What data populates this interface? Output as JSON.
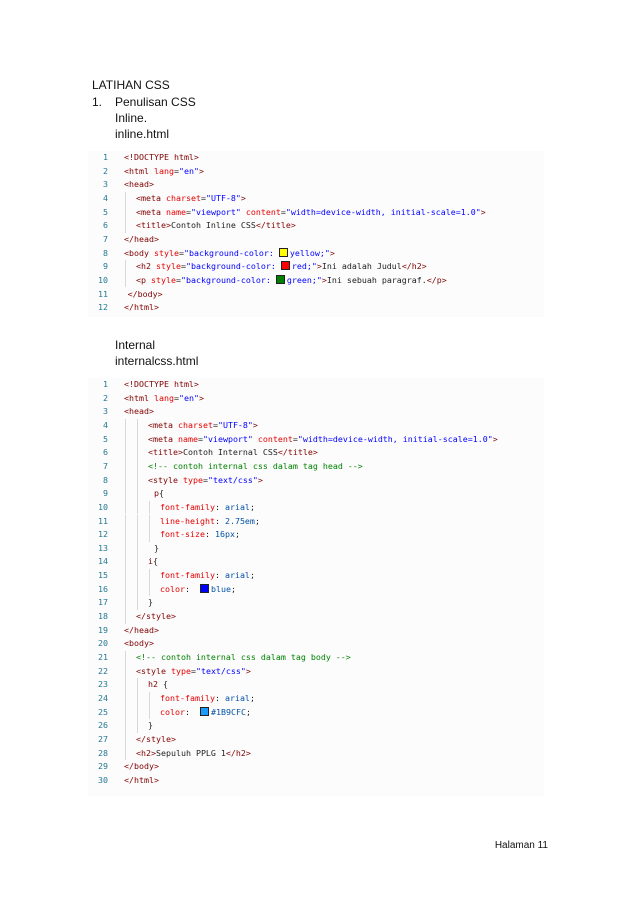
{
  "doc": {
    "heading": "LATIHAN CSS",
    "list_number": "1.",
    "section": "Penulisan CSS",
    "inline_label": "Inline.",
    "inline_file": "inline.html",
    "internal_label": "Internal",
    "internal_file": "internalcss.html",
    "footer": "Halaman 11"
  },
  "colors": {
    "yellow_swatch": "#ffff00",
    "red_swatch": "#ff0000",
    "green_swatch": "#008000",
    "blue_swatch": "#0000ff",
    "light_blue_swatch": "#1b9cfc"
  },
  "code1": [
    {
      "n": "1",
      "ind": 0,
      "parts": [
        [
          "t",
          "<!DOCTYPE html>"
        ]
      ]
    },
    {
      "n": "2",
      "ind": 0,
      "parts": [
        [
          "t",
          "<html "
        ],
        [
          "a",
          "lang"
        ],
        [
          "p",
          "="
        ],
        [
          "v",
          "\"en\""
        ],
        [
          "t",
          ">"
        ]
      ]
    },
    {
      "n": "3",
      "ind": 0,
      "parts": [
        [
          "t",
          "<head>"
        ]
      ]
    },
    {
      "n": "4",
      "ind": 1,
      "parts": [
        [
          "t",
          "<meta "
        ],
        [
          "a",
          "charset"
        ],
        [
          "p",
          "="
        ],
        [
          "v",
          "\"UTF-8\""
        ],
        [
          "t",
          ">"
        ]
      ]
    },
    {
      "n": "5",
      "ind": 1,
      "parts": [
        [
          "t",
          "<meta "
        ],
        [
          "a",
          "name"
        ],
        [
          "p",
          "="
        ],
        [
          "v",
          "\"viewport\""
        ],
        [
          "p",
          " "
        ],
        [
          "a",
          "content"
        ],
        [
          "p",
          "="
        ],
        [
          "v",
          "\"width=device-width, initial-scale=1.0\""
        ],
        [
          "t",
          ">"
        ]
      ]
    },
    {
      "n": "6",
      "ind": 1,
      "parts": [
        [
          "t",
          "<title>"
        ],
        [
          "p",
          "Contoh Inline CSS"
        ],
        [
          "t",
          "</title>"
        ]
      ]
    },
    {
      "n": "7",
      "ind": 0,
      "parts": [
        [
          "t",
          "</head>"
        ]
      ]
    },
    {
      "n": "8",
      "ind": 0,
      "parts": [
        [
          "t",
          "<body "
        ],
        [
          "a",
          "style"
        ],
        [
          "p",
          "="
        ],
        [
          "v",
          "\"background-color: "
        ],
        [
          "sw",
          "yellow_swatch"
        ],
        [
          "v",
          "yellow;\""
        ],
        [
          "t",
          ">"
        ]
      ]
    },
    {
      "n": "9",
      "ind": 1,
      "parts": [
        [
          "t",
          "<h2 "
        ],
        [
          "a",
          "style"
        ],
        [
          "p",
          "="
        ],
        [
          "v",
          "\"background-color: "
        ],
        [
          "sw",
          "red_swatch"
        ],
        [
          "v",
          "red;\""
        ],
        [
          "t",
          ">"
        ],
        [
          "p",
          "Ini adalah Judul"
        ],
        [
          "t",
          "</h2>"
        ]
      ]
    },
    {
      "n": "10",
      "ind": 1,
      "parts": [
        [
          "t",
          "<p "
        ],
        [
          "a",
          "style"
        ],
        [
          "p",
          "="
        ],
        [
          "v",
          "\"background-color: "
        ],
        [
          "sw",
          "green_swatch"
        ],
        [
          "v",
          "green;\""
        ],
        [
          "t",
          ">"
        ],
        [
          "p",
          "Ini sebuah paragraf."
        ],
        [
          "t",
          "</p>"
        ]
      ]
    },
    {
      "n": "11",
      "ind": 0.3,
      "parts": [
        [
          "t",
          "</body>"
        ]
      ]
    },
    {
      "n": "12",
      "ind": 0,
      "parts": [
        [
          "t",
          "</html>"
        ]
      ]
    }
  ],
  "code2": [
    {
      "n": "1",
      "ind": 0,
      "parts": [
        [
          "t",
          "<!DOCTYPE html>"
        ]
      ]
    },
    {
      "n": "2",
      "ind": 0,
      "parts": [
        [
          "t",
          "<html "
        ],
        [
          "a",
          "lang"
        ],
        [
          "p",
          "="
        ],
        [
          "v",
          "\"en\""
        ],
        [
          "t",
          ">"
        ]
      ]
    },
    {
      "n": "3",
      "ind": 0,
      "parts": [
        [
          "t",
          "<head>"
        ]
      ]
    },
    {
      "n": "4",
      "ind": 2,
      "parts": [
        [
          "t",
          "<meta "
        ],
        [
          "a",
          "charset"
        ],
        [
          "p",
          "="
        ],
        [
          "v",
          "\"UTF-8\""
        ],
        [
          "t",
          ">"
        ]
      ]
    },
    {
      "n": "5",
      "ind": 2,
      "parts": [
        [
          "t",
          "<meta "
        ],
        [
          "a",
          "name"
        ],
        [
          "p",
          "="
        ],
        [
          "v",
          "\"viewport\""
        ],
        [
          "p",
          " "
        ],
        [
          "a",
          "content"
        ],
        [
          "p",
          "="
        ],
        [
          "v",
          "\"width=device-width, initial-scale=1.0\""
        ],
        [
          "t",
          ">"
        ]
      ]
    },
    {
      "n": "6",
      "ind": 2,
      "parts": [
        [
          "t",
          "<title>"
        ],
        [
          "p",
          "Contoh Internal CSS"
        ],
        [
          "t",
          "</title>"
        ]
      ]
    },
    {
      "n": "7",
      "ind": 2,
      "parts": [
        [
          "c",
          "<!-- contoh internal css dalam tag head -->"
        ]
      ]
    },
    {
      "n": "8",
      "ind": 2,
      "parts": [
        [
          "t",
          "<style "
        ],
        [
          "a",
          "type"
        ],
        [
          "p",
          "="
        ],
        [
          "v",
          "\"text/css\""
        ],
        [
          "t",
          ">"
        ]
      ]
    },
    {
      "n": "9",
      "ind": 2.5,
      "parts": [
        [
          "t",
          "p"
        ],
        [
          "p",
          "{"
        ]
      ]
    },
    {
      "n": "10",
      "ind": 3,
      "parts": [
        [
          "a",
          "font-family"
        ],
        [
          "p",
          ": "
        ],
        [
          "cv",
          "arial"
        ],
        [
          "p",
          ";"
        ]
      ]
    },
    {
      "n": "11",
      "ind": 3,
      "parts": [
        [
          "a",
          "line-height"
        ],
        [
          "p",
          ": "
        ],
        [
          "cv",
          "2.75em"
        ],
        [
          "p",
          ";"
        ]
      ]
    },
    {
      "n": "12",
      "ind": 3,
      "parts": [
        [
          "a",
          "font-size"
        ],
        [
          "p",
          ": "
        ],
        [
          "cv",
          "16px"
        ],
        [
          "p",
          ";"
        ]
      ]
    },
    {
      "n": "13",
      "ind": 2.5,
      "parts": [
        [
          "p",
          "}"
        ]
      ]
    },
    {
      "n": "14",
      "ind": 2,
      "parts": [
        [
          "t",
          "i"
        ],
        [
          "p",
          "{"
        ]
      ]
    },
    {
      "n": "15",
      "ind": 3,
      "parts": [
        [
          "a",
          "font-family"
        ],
        [
          "p",
          ": "
        ],
        [
          "cv",
          "arial"
        ],
        [
          "p",
          ";"
        ]
      ]
    },
    {
      "n": "16",
      "ind": 3,
      "parts": [
        [
          "a",
          "color"
        ],
        [
          "p",
          ":  "
        ],
        [
          "sw",
          "blue_swatch"
        ],
        [
          "cv",
          "blue"
        ],
        [
          "p",
          ";"
        ]
      ]
    },
    {
      "n": "17",
      "ind": 2,
      "parts": [
        [
          "p",
          "}"
        ]
      ]
    },
    {
      "n": "18",
      "ind": 1,
      "parts": [
        [
          "t",
          "</style>"
        ]
      ]
    },
    {
      "n": "19",
      "ind": 0,
      "parts": [
        [
          "t",
          "</head>"
        ]
      ]
    },
    {
      "n": "20",
      "ind": 0,
      "parts": [
        [
          "t",
          "<body>"
        ]
      ]
    },
    {
      "n": "21",
      "ind": 1,
      "parts": [
        [
          "c",
          "<!-- contoh internal css dalam tag body -->"
        ]
      ]
    },
    {
      "n": "22",
      "ind": 1,
      "parts": [
        [
          "t",
          "<style "
        ],
        [
          "a",
          "type"
        ],
        [
          "p",
          "="
        ],
        [
          "v",
          "\"text/css\""
        ],
        [
          "t",
          ">"
        ]
      ]
    },
    {
      "n": "23",
      "ind": 2,
      "parts": [
        [
          "t",
          "h2"
        ],
        [
          "p",
          " {"
        ]
      ]
    },
    {
      "n": "24",
      "ind": 3,
      "parts": [
        [
          "a",
          "font-family"
        ],
        [
          "p",
          ": "
        ],
        [
          "cv",
          "arial"
        ],
        [
          "p",
          ";"
        ]
      ]
    },
    {
      "n": "25",
      "ind": 3,
      "parts": [
        [
          "a",
          "color"
        ],
        [
          "p",
          ":  "
        ],
        [
          "sw",
          "light_blue_swatch"
        ],
        [
          "cv",
          "#1B9CFC"
        ],
        [
          "p",
          ";"
        ]
      ]
    },
    {
      "n": "26",
      "ind": 2,
      "parts": [
        [
          "p",
          "}"
        ]
      ]
    },
    {
      "n": "27",
      "ind": 1,
      "parts": [
        [
          "t",
          "</style>"
        ]
      ]
    },
    {
      "n": "28",
      "ind": 1,
      "parts": [
        [
          "t",
          "<h2>"
        ],
        [
          "p",
          "Sepuluh PPLG 1"
        ],
        [
          "t",
          "</h2>"
        ]
      ]
    },
    {
      "n": "29",
      "ind": 0,
      "parts": [
        [
          "t",
          "</body>"
        ]
      ]
    },
    {
      "n": "30",
      "ind": 0,
      "parts": [
        [
          "t",
          "</html>"
        ]
      ]
    }
  ]
}
